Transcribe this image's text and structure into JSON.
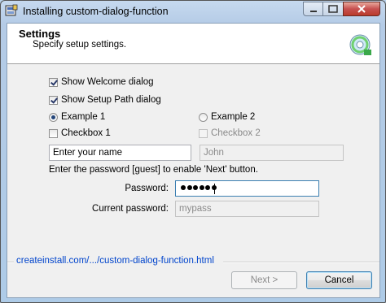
{
  "window": {
    "title": "Installing custom-dialog-function"
  },
  "header": {
    "title": "Settings",
    "subtitle": "Specify setup settings."
  },
  "options": {
    "show_welcome": {
      "label": "Show Welcome dialog",
      "checked": true
    },
    "show_setup_path": {
      "label": "Show Setup Path dialog",
      "checked": true
    },
    "example1": {
      "label": "Example 1",
      "selected": true
    },
    "example2": {
      "label": "Example 2",
      "selected": false
    },
    "checkbox1": {
      "label": "Checkbox 1",
      "checked": false
    },
    "checkbox2": {
      "label": "Checkbox 2",
      "checked": false,
      "disabled": true
    }
  },
  "name_input": {
    "value": "Enter your name"
  },
  "name_disabled": {
    "value": "John"
  },
  "password_info": "Enter the password [guest] to enable 'Next' button.",
  "password": {
    "label": "Password:",
    "masked_length": 6
  },
  "current_password": {
    "label": "Current password:",
    "value": "mypass"
  },
  "link": "createinstall.com/.../custom-dialog-function.html",
  "buttons": {
    "next": "Next >",
    "cancel": "Cancel"
  }
}
